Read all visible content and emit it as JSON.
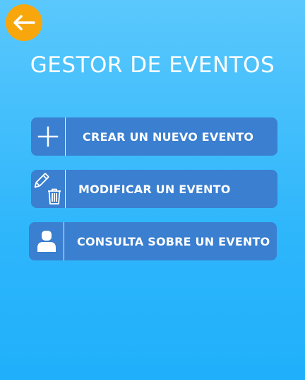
{
  "header": {
    "back_icon": "arrow-left-icon",
    "title": "GESTOR DE EVENTOS"
  },
  "menu": {
    "items": [
      {
        "label": "CREAR UN NUEVO EVENTO",
        "icon": "plus-icon"
      },
      {
        "label": "MODIFICAR UN EVENTO",
        "icon": "pencil-trash-icon"
      },
      {
        "label": "CONSULTA SOBRE UN EVENTO",
        "icon": "user-icon"
      }
    ]
  },
  "colors": {
    "accent": "#f7a70c",
    "button": "#3a7fd0",
    "background_top": "#5ac8fc",
    "background_bottom": "#1fb0fb",
    "text": "#ffffff"
  }
}
